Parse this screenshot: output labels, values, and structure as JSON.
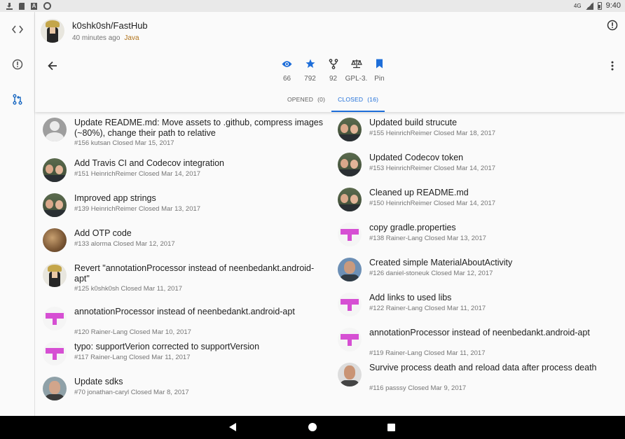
{
  "status_bar": {
    "time": "9:40",
    "network": "4G"
  },
  "repo": {
    "name": "k0shk0sh/FastHub",
    "updated": "40 minutes ago",
    "language": "Java",
    "language_color": "#b07219"
  },
  "stats": [
    {
      "icon": "eye-icon",
      "label": "66"
    },
    {
      "icon": "star-icon",
      "label": "792"
    },
    {
      "icon": "fork-icon",
      "label": "92"
    },
    {
      "icon": "scale-icon",
      "label": "GPL-3."
    },
    {
      "icon": "bookmark-icon",
      "label": "Pin"
    }
  ],
  "tabs": [
    {
      "label": "OPENED",
      "count": "(0)",
      "active": false
    },
    {
      "label": "CLOSED",
      "count": "(16)",
      "active": true
    }
  ],
  "colors": {
    "accent": "#1e6ed9",
    "pixel_avatar": "#d64fd3"
  },
  "pull_requests_left": [
    {
      "title": "Update README.md: Move assets to .github, compress images (~80%), change their path to relative",
      "sub": "#156 kutsan Closed Mar 15, 2017",
      "avatar": "gray"
    },
    {
      "title": "Add Travis CI and Codecov integration",
      "sub": "#151 HeinrichReimer Closed Mar 14, 2017",
      "avatar": "pair"
    },
    {
      "title": "Improved app strings",
      "sub": "#139 HeinrichReimer Closed Mar 13, 2017",
      "avatar": "pair"
    },
    {
      "title": "Add OTP code",
      "sub": "#133 alorma Closed Mar 12, 2017",
      "avatar": "wood"
    },
    {
      "title": "Revert \"annotationProcessor instead of neenbedankt.android-apt\"",
      "sub": "#125 k0shk0sh Closed Mar 11, 2017",
      "avatar": "hat"
    },
    {
      "title": "annotationProcessor instead of neenbedankt.android-apt",
      "sub": "#120 Rainer-Lang Closed Mar 10, 2017",
      "avatar": "pixel"
    },
    {
      "title": "typo: supportVerion corrected to supportVersion",
      "sub": "#117 Rainer-Lang Closed Mar 11, 2017",
      "avatar": "pixel"
    },
    {
      "title": "Update sdks",
      "sub": "#70 jonathan-caryl Closed Mar 8, 2017",
      "avatar": "face"
    }
  ],
  "pull_requests_right": [
    {
      "title": "Updated build strucute",
      "sub": "#155 HeinrichReimer Closed Mar 18, 2017",
      "avatar": "pair"
    },
    {
      "title": "Updated Codecov token",
      "sub": "#153 HeinrichReimer Closed Mar 14, 2017",
      "avatar": "pair"
    },
    {
      "title": "Cleaned up README.md",
      "sub": "#150 HeinrichReimer Closed Mar 14, 2017",
      "avatar": "pair"
    },
    {
      "title": "copy gradle.properties",
      "sub": "#138 Rainer-Lang Closed Mar 13, 2017",
      "avatar": "pixel"
    },
    {
      "title": "Created simple MaterialAboutActivity",
      "sub": "#126 daniel-stoneuk Closed Mar 12, 2017",
      "avatar": "blue"
    },
    {
      "title": "Add links to used libs",
      "sub": "#122 Rainer-Lang Closed Mar 11, 2017",
      "avatar": "pixel"
    },
    {
      "title": "annotationProcessor instead of neenbedankt.android-apt",
      "sub": "#119 Rainer-Lang Closed Mar 11, 2017",
      "avatar": "pixel"
    },
    {
      "title": "Survive process death and reload data after process death",
      "sub": "#116 passsy Closed Mar 9, 2017",
      "avatar": "photo"
    }
  ]
}
